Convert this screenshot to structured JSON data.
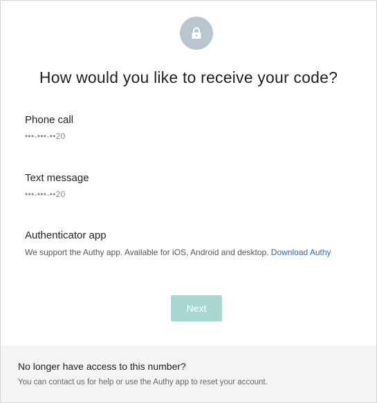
{
  "icons": {
    "lock": "lock-icon"
  },
  "colors": {
    "accent": "#a8d8cf",
    "link": "#2a67b1",
    "lock_bg": "#b9c6d2"
  },
  "title": "How would you like to receive your code?",
  "options": [
    {
      "label": "Phone call",
      "value": "•••-•••-••20"
    },
    {
      "label": "Text message",
      "value": "•••-•••-••20"
    },
    {
      "label": "Authenticator app",
      "desc": "We support the Authy app. Available for iOS, Android and desktop.",
      "link": "Download Authy"
    }
  ],
  "next_label": "Next",
  "footer": {
    "title": "No longer have access to this number?",
    "desc": "You can contact us for help or use the Authy app to reset your account."
  }
}
